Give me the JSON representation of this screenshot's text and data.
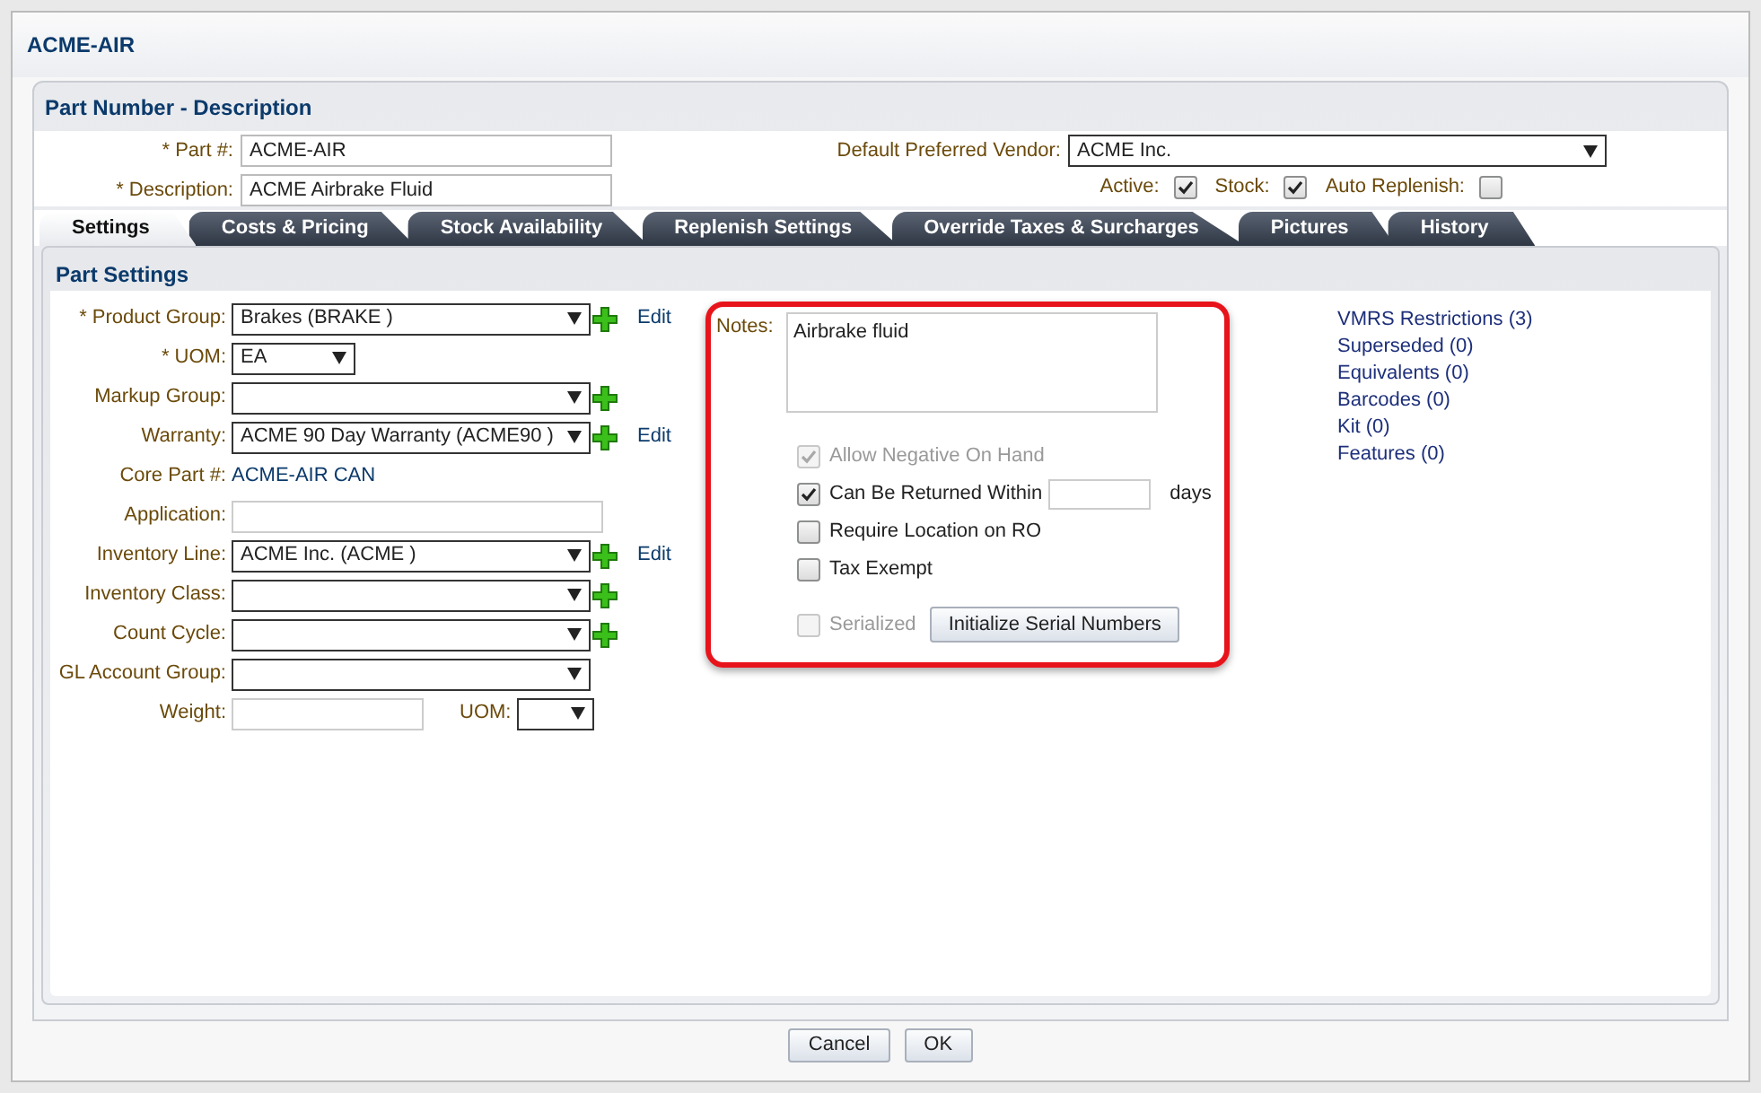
{
  "window": {
    "title": "ACME-AIR"
  },
  "header": {
    "title": "Part Number - Description",
    "part_number": {
      "label": "* Part #:",
      "value": "ACME-AIR"
    },
    "description": {
      "label": "* Description:",
      "value": "ACME Airbrake Fluid"
    },
    "vendor": {
      "label": "Default Preferred Vendor:",
      "value": "ACME Inc."
    },
    "flags": [
      {
        "label": "Active:",
        "checked": true
      },
      {
        "label": "Stock:",
        "checked": true
      },
      {
        "label": "Auto Replenish:",
        "checked": false
      }
    ]
  },
  "tabs": [
    {
      "label": "Settings",
      "selected": true
    },
    {
      "label": "Costs & Pricing",
      "selected": false
    },
    {
      "label": "Stock Availability",
      "selected": false
    },
    {
      "label": "Replenish Settings",
      "selected": false
    },
    {
      "label": "Override Taxes & Surcharges",
      "selected": false
    },
    {
      "label": "Pictures",
      "selected": false
    },
    {
      "label": "History",
      "selected": false
    }
  ],
  "part_settings": {
    "title": "Part Settings",
    "fields": [
      {
        "kind": "select",
        "label": "* Product Group:",
        "value": "Brakes (BRAKE )",
        "add": true,
        "edit": "Edit"
      },
      {
        "kind": "short-select",
        "label": "* UOM:",
        "value": "EA",
        "add": false
      },
      {
        "kind": "select",
        "label": "Markup Group:",
        "add": true
      },
      {
        "kind": "select",
        "label": "Warranty:",
        "value": "ACME 90 Day Warranty (ACME90 )",
        "add": true,
        "edit": "Edit"
      },
      {
        "kind": "static",
        "label": "Core Part #:",
        "value": "ACME-AIR CAN",
        "add": false
      },
      {
        "kind": "text",
        "label": "Application:",
        "add": false
      },
      {
        "kind": "select",
        "label": "Inventory Line:",
        "value": "ACME Inc. (ACME )",
        "add": true,
        "edit": "Edit"
      },
      {
        "kind": "select",
        "label": "Inventory Class:",
        "add": true
      },
      {
        "kind": "select",
        "label": "Count Cycle:",
        "add": true
      },
      {
        "kind": "select",
        "label": "GL Account Group:",
        "add": false
      },
      {
        "kind": "weight",
        "label": "Weight:",
        "add": false,
        "unit_label": "UOM:"
      }
    ]
  },
  "notes": {
    "label": "Notes:",
    "value": "Airbrake fluid"
  },
  "options": [
    {
      "kind": "plain",
      "label": "Allow Negative On Hand",
      "checked": true,
      "disabled": true
    },
    {
      "kind": "days",
      "label": "Can Be Returned Within",
      "checked": true,
      "disabled": false,
      "suffix": "days"
    },
    {
      "kind": "plain",
      "label": "Require Location on RO",
      "checked": false,
      "disabled": false
    },
    {
      "kind": "plain",
      "label": "Tax Exempt",
      "checked": false,
      "disabled": false
    },
    {
      "kind": "button",
      "label": "Serialized",
      "checked": false,
      "disabled": true,
      "button": "Initialize Serial Numbers"
    }
  ],
  "links": [
    "VMRS Restrictions (3)",
    "Superseded (0)",
    "Equivalents (0)",
    "Barcodes (0)",
    "Kit (0)",
    "Features (0)"
  ],
  "buttons": [
    "Cancel",
    "OK"
  ]
}
